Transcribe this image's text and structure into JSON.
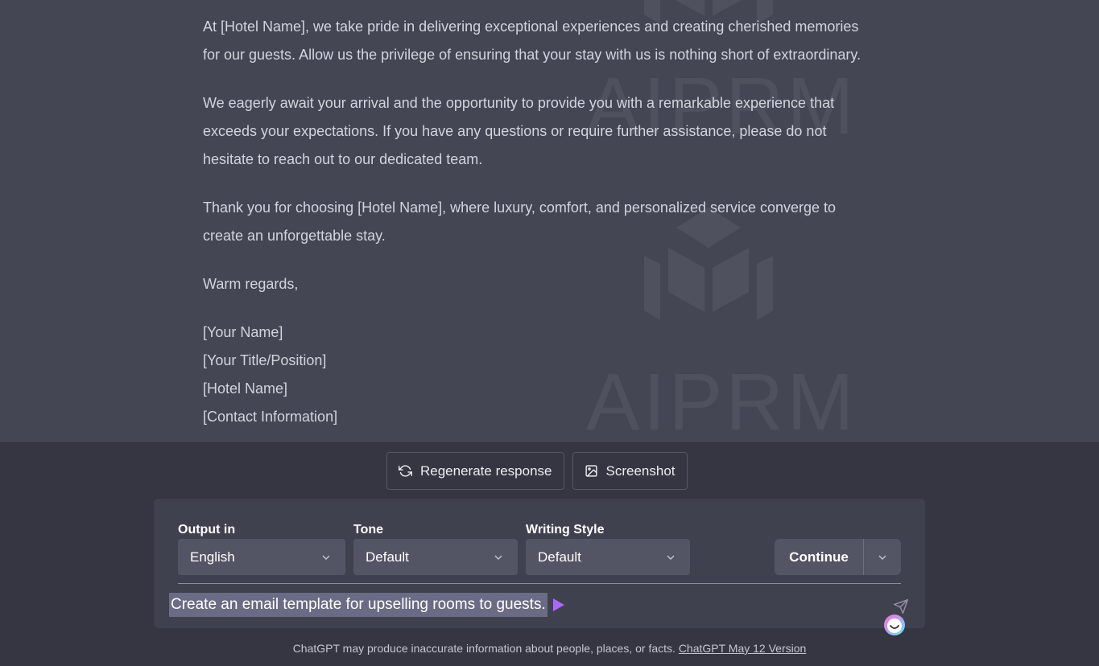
{
  "watermark": {
    "text": "AIPRM"
  },
  "message": {
    "paragraphs": [
      "At [Hotel Name], we take pride in delivering exceptional experiences and creating cherished memories for our guests. Allow us the privilege of ensuring that your stay with us is nothing short of extraordinary.",
      "We eagerly await your arrival and the opportunity to provide you with a remarkable experience that exceeds your expectations. If you have any questions or require further assistance, please do not hesitate to reach out to our dedicated team.",
      "Thank you for choosing [Hotel Name], where luxury, comfort, and personalized service converge to create an unforgettable stay.",
      "Warm regards,"
    ],
    "signature": [
      "[Your Name]",
      "[Your Title/Position]",
      "[Hotel Name]",
      "[Contact Information]"
    ]
  },
  "actions": {
    "regenerate_label": "Regenerate response",
    "screenshot_label": "Screenshot"
  },
  "controls": {
    "output_label": "Output in",
    "output_value": "English",
    "tone_label": "Tone",
    "tone_value": "Default",
    "style_label": "Writing Style",
    "style_value": "Default",
    "continue_label": "Continue"
  },
  "prompt": {
    "text": "Create an email template for upselling rooms to guests."
  },
  "footer": {
    "disclaimer": "ChatGPT may produce inaccurate information about people, places, or facts. ",
    "version_link": "ChatGPT May 12 Version"
  },
  "colors": {
    "background": "#444654",
    "panel": "#353641",
    "input": "#40414f",
    "accent": "#ab68ff"
  }
}
